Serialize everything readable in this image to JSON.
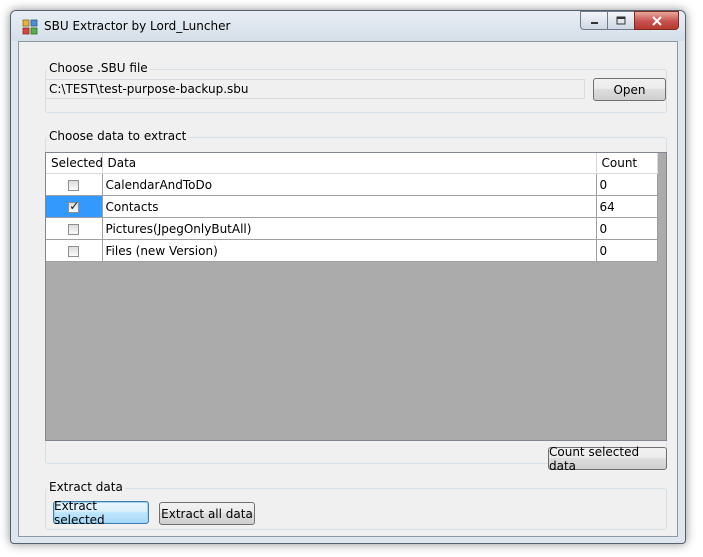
{
  "window": {
    "title": "SBU Extractor by Lord_Luncher",
    "icon": "app-icon",
    "controls": {
      "minimize": "minimize-icon",
      "maximize": "maximize-icon",
      "close": "close-icon"
    }
  },
  "file_group": {
    "legend": "Choose .SBU file",
    "path_value": "C:\\TEST\\test-purpose-backup.sbu",
    "open_label": "Open"
  },
  "data_group": {
    "legend": "Choose data to extract",
    "columns": [
      "Selected",
      "Data",
      "Count"
    ],
    "rows": [
      {
        "selected": false,
        "data": "CalendarAndToDo",
        "count": "0"
      },
      {
        "selected": true,
        "data": "Contacts",
        "count": "64"
      },
      {
        "selected": false,
        "data": "Pictures(JpegOnlyButAll)",
        "count": "0"
      },
      {
        "selected": false,
        "data": "Files (new Version)",
        "count": "0"
      }
    ],
    "count_button_label": "Count selected data"
  },
  "extract_group": {
    "legend": "Extract data",
    "extract_selected_label": "Extract selected",
    "extract_all_label": "Extract all data"
  },
  "colors": {
    "selection": "#3399ff",
    "grid_background": "#ababab",
    "form_background": "#f0f0f0"
  }
}
